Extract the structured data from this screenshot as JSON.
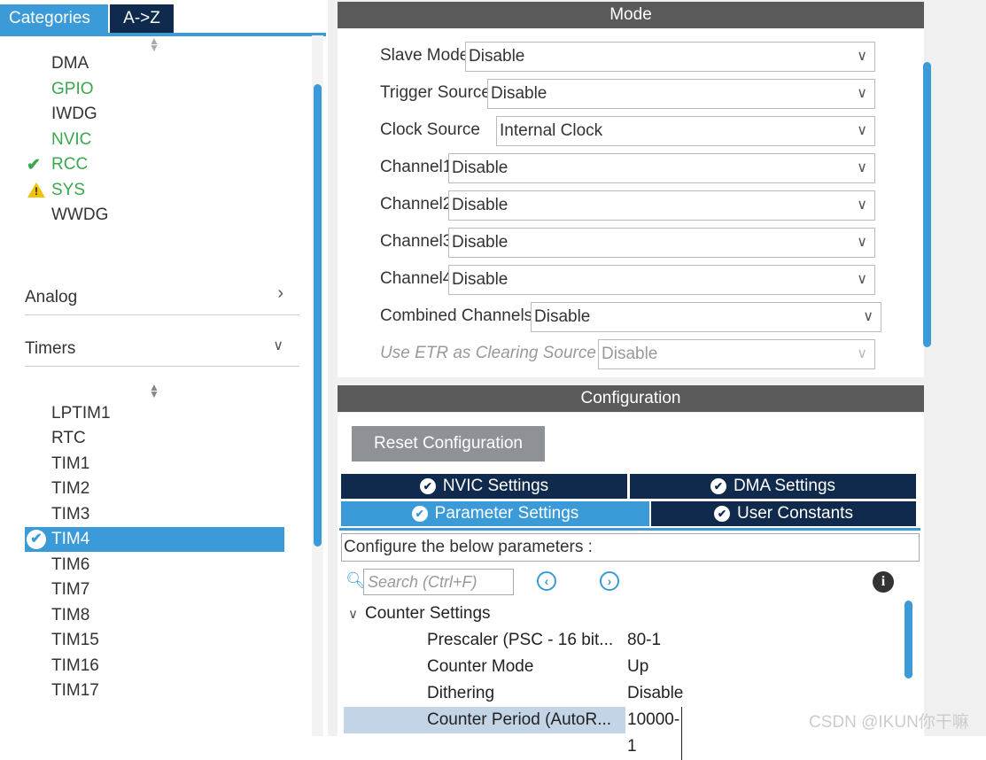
{
  "left": {
    "tabs": {
      "categories": "Categories",
      "az": "A->Z"
    },
    "categories": [
      {
        "label": "DMA",
        "status": "none"
      },
      {
        "label": "GPIO",
        "status": "green"
      },
      {
        "label": "IWDG",
        "status": "none"
      },
      {
        "label": "NVIC",
        "status": "green"
      },
      {
        "label": "RCC",
        "status": "ok"
      },
      {
        "label": "SYS",
        "status": "warning"
      },
      {
        "label": "WWDG",
        "status": "none"
      }
    ],
    "sections": {
      "analog": "Analog",
      "timers": "Timers"
    },
    "timers": [
      "LPTIM1",
      "RTC",
      "TIM1",
      "TIM2",
      "TIM3",
      "TIM4",
      "TIM6",
      "TIM7",
      "TIM8",
      "TIM15",
      "TIM16",
      "TIM17"
    ],
    "selected_timer": "TIM4"
  },
  "mode": {
    "header": "Mode",
    "fields": [
      {
        "label": "Slave Mode",
        "value": "Disable"
      },
      {
        "label": "Trigger Source",
        "value": "Disable"
      },
      {
        "label": "Clock Source",
        "value": "Internal Clock"
      },
      {
        "label": "Channel1",
        "value": "Disable"
      },
      {
        "label": "Channel2",
        "value": "Disable"
      },
      {
        "label": "Channel3",
        "value": "Disable"
      },
      {
        "label": "Channel4",
        "value": "Disable"
      },
      {
        "label": "Combined Channels",
        "value": "Disable"
      },
      {
        "label": "Use ETR as Clearing Source",
        "value": "Disable"
      }
    ]
  },
  "config": {
    "header": "Configuration",
    "reset_label": "Reset Configuration",
    "tabs": {
      "nvic": "NVIC Settings",
      "dma": "DMA Settings",
      "parameter": "Parameter Settings",
      "user": "User Constants"
    },
    "configure_text": "Configure the below parameters :",
    "search_placeholder": "Search (Ctrl+F)",
    "group": "Counter Settings",
    "params": [
      {
        "name": "Prescaler (PSC - 16 bit...",
        "value": "80-1"
      },
      {
        "name": "Counter Mode",
        "value": "Up"
      },
      {
        "name": "Dithering",
        "value": "Disable"
      },
      {
        "name": "Counter Period (AutoR...",
        "value": "10000-1"
      }
    ]
  },
  "watermark": "CSDN @IKUN你干嘛"
}
